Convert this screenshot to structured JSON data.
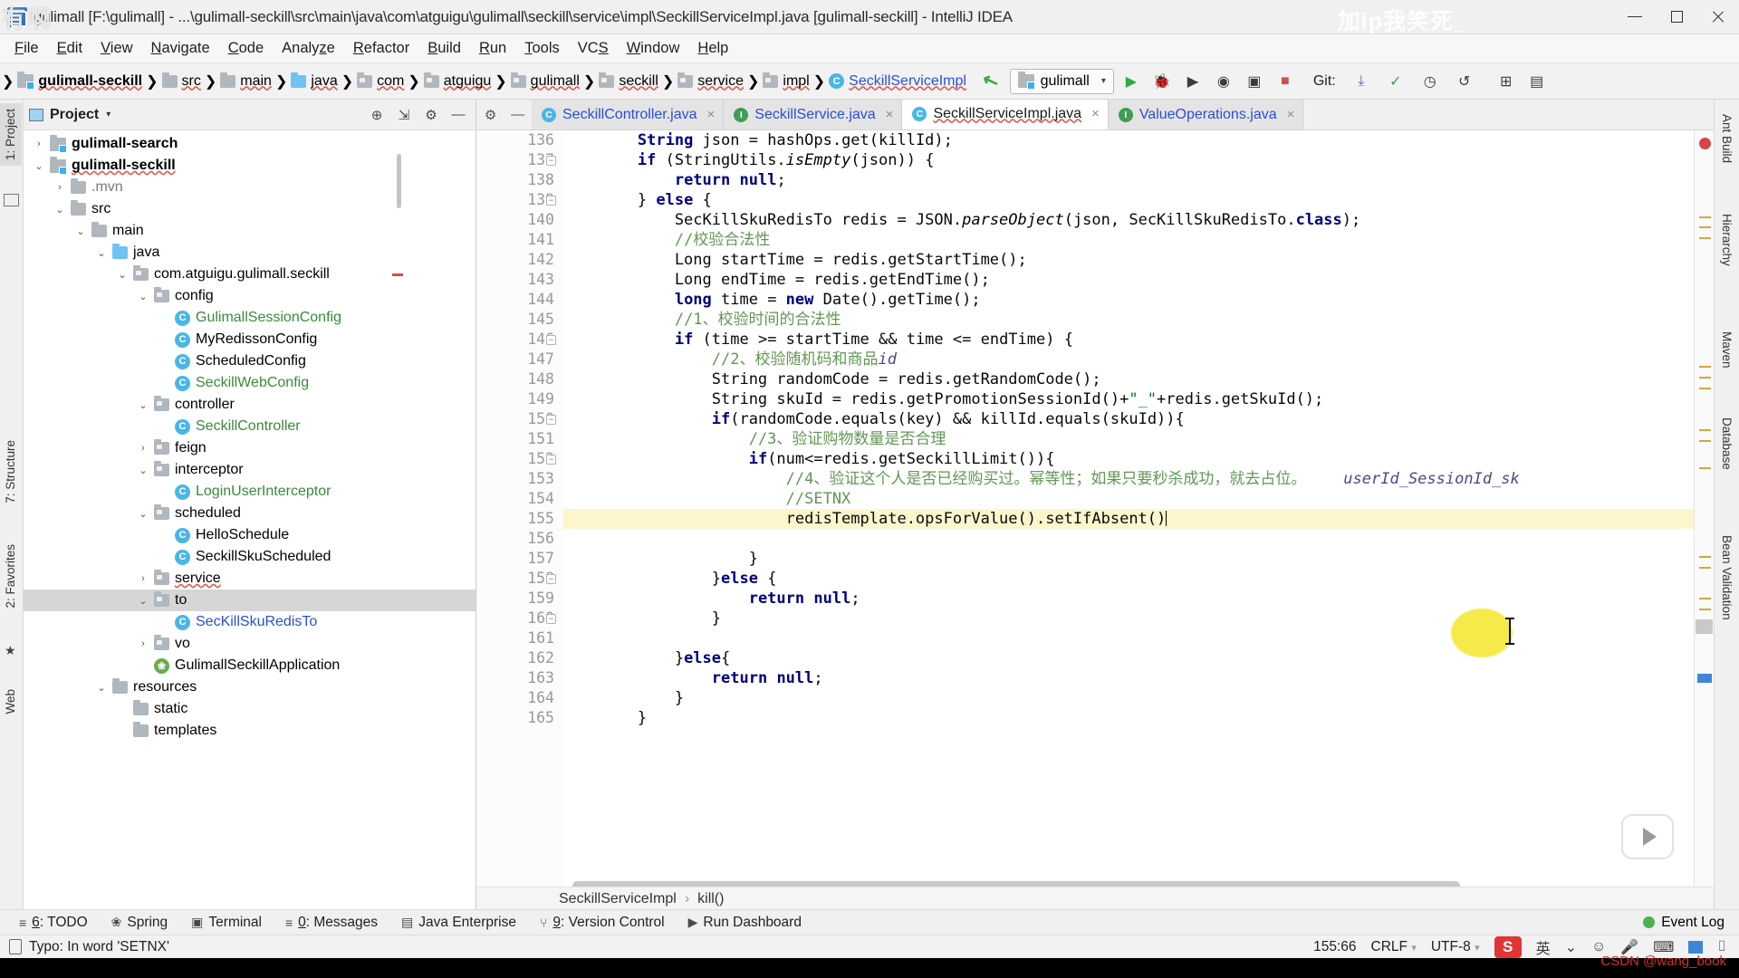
{
  "window": {
    "title": "gulimall [F:\\gulimall] - ...\\gulimall-seckill\\src\\main\\java\\com\\atguigu\\gulimall\\seckill\\service\\impl\\SeckillServiceImpl.java [gulimall-seckill] - IntelliJ IDEA",
    "minimize_label": "minimize",
    "maximize_label": "maximize",
    "close_label": "close"
  },
  "watermarks": {
    "top_left": "有啊",
    "top_right": "加ip我笑死_",
    "bottom_right": "CSDN @wang_book"
  },
  "menu": [
    {
      "label": "File",
      "mnemonic": "F"
    },
    {
      "label": "Edit",
      "mnemonic": "E"
    },
    {
      "label": "View",
      "mnemonic": "V"
    },
    {
      "label": "Navigate",
      "mnemonic": "N"
    },
    {
      "label": "Code",
      "mnemonic": "C"
    },
    {
      "label": "Analyze",
      "mnemonic": "z"
    },
    {
      "label": "Refactor",
      "mnemonic": "R"
    },
    {
      "label": "Build",
      "mnemonic": "B"
    },
    {
      "label": "Run",
      "mnemonic": "R"
    },
    {
      "label": "Tools",
      "mnemonic": "T"
    },
    {
      "label": "VCS",
      "mnemonic": "S"
    },
    {
      "label": "Window",
      "mnemonic": "W"
    },
    {
      "label": "Help",
      "mnemonic": "H"
    }
  ],
  "breadcrumb": [
    {
      "label": "gulimall-seckill",
      "icon": "module-icon",
      "style": "module"
    },
    {
      "label": "src",
      "icon": "folder-icon",
      "style": "folder"
    },
    {
      "label": "main",
      "icon": "folder-icon",
      "style": "folder"
    },
    {
      "label": "java",
      "icon": "source-folder-icon",
      "style": "source"
    },
    {
      "label": "com",
      "icon": "package-icon",
      "style": "package"
    },
    {
      "label": "atguigu",
      "icon": "package-icon",
      "style": "package"
    },
    {
      "label": "gulimall",
      "icon": "package-icon",
      "style": "package"
    },
    {
      "label": "seckill",
      "icon": "package-icon",
      "style": "package"
    },
    {
      "label": "service",
      "icon": "package-icon",
      "style": "package"
    },
    {
      "label": "impl",
      "icon": "package-icon",
      "style": "package"
    },
    {
      "label": "SeckillServiceImpl",
      "icon": "class-icon",
      "style": "class"
    }
  ],
  "toolbar": {
    "run_config": "gulimall",
    "git_label": "Git:",
    "run_icon": "run-icon",
    "debug_icon": "debug-icon",
    "coverage_icon": "coverage-icon",
    "profile_icon": "profile-icon",
    "build_icon": "build-icon",
    "stop_icon": "stop-icon",
    "update_icon": "vcs-update-icon",
    "commit_icon": "vcs-commit-icon",
    "history_icon": "vcs-history-icon",
    "rollback_icon": "vcs-rollback-icon",
    "search_everywhere_icon": "search-everywhere-icon",
    "settings_icon": "settings-icon"
  },
  "left_tool_strip": [
    {
      "label": "1: Project",
      "selected": true
    },
    {
      "label": "2: Favorites",
      "selected": false
    },
    {
      "label": "7: Structure",
      "selected": false
    },
    {
      "label": "Web",
      "selected": false
    }
  ],
  "right_tool_strip": [
    {
      "label": "Ant Build"
    },
    {
      "label": "Hierarchy"
    },
    {
      "label": "Maven"
    },
    {
      "label": "Database"
    },
    {
      "label": "Bean Validation"
    }
  ],
  "project_panel": {
    "title": "Project",
    "caret": "▾",
    "actions": [
      "locate-icon",
      "collapse-all-icon",
      "settings-icon",
      "hide-icon"
    ],
    "tree": [
      {
        "depth": 1,
        "arrow": "collapsed",
        "icon": "module-icon",
        "label": "gulimall-search",
        "style": "bold"
      },
      {
        "depth": 1,
        "arrow": "expanded",
        "icon": "module-icon",
        "label": "gulimall-seckill",
        "style": "bold-squiggle"
      },
      {
        "depth": 2,
        "arrow": "collapsed",
        "icon": "folder-icon",
        "label": ".mvn",
        "style": "gray"
      },
      {
        "depth": 2,
        "arrow": "expanded",
        "icon": "folder-icon",
        "label": "src",
        "style": "plain"
      },
      {
        "depth": 3,
        "arrow": "expanded",
        "icon": "folder-icon",
        "label": "main",
        "style": "plain"
      },
      {
        "depth": 4,
        "arrow": "expanded",
        "icon": "source-folder-icon",
        "label": "java",
        "style": "plain"
      },
      {
        "depth": 5,
        "arrow": "expanded",
        "icon": "package-icon",
        "label": "com.atguigu.gulimall.seckill",
        "style": "plain"
      },
      {
        "depth": 6,
        "arrow": "expanded",
        "icon": "package-icon",
        "label": "config",
        "style": "plain"
      },
      {
        "depth": 7,
        "arrow": "none",
        "icon": "class-icon",
        "label": "GulimallSessionConfig",
        "style": "green"
      },
      {
        "depth": 7,
        "arrow": "none",
        "icon": "class-icon",
        "label": "MyRedissonConfig",
        "style": "plain"
      },
      {
        "depth": 7,
        "arrow": "none",
        "icon": "class-icon",
        "label": "ScheduledConfig",
        "style": "plain"
      },
      {
        "depth": 7,
        "arrow": "none",
        "icon": "class-icon",
        "label": "SeckillWebConfig",
        "style": "green"
      },
      {
        "depth": 6,
        "arrow": "expanded",
        "icon": "package-icon",
        "label": "controller",
        "style": "plain"
      },
      {
        "depth": 7,
        "arrow": "none",
        "icon": "class-icon",
        "label": "SeckillController",
        "style": "green"
      },
      {
        "depth": 6,
        "arrow": "collapsed",
        "icon": "package-icon",
        "label": "feign",
        "style": "plain"
      },
      {
        "depth": 6,
        "arrow": "expanded",
        "icon": "package-icon",
        "label": "interceptor",
        "style": "plain"
      },
      {
        "depth": 7,
        "arrow": "none",
        "icon": "class-icon",
        "label": "LoginUserInterceptor",
        "style": "green"
      },
      {
        "depth": 6,
        "arrow": "expanded",
        "icon": "package-icon",
        "label": "scheduled",
        "style": "plain"
      },
      {
        "depth": 7,
        "arrow": "none",
        "icon": "class-icon",
        "label": "HelloSchedule",
        "style": "plain"
      },
      {
        "depth": 7,
        "arrow": "none",
        "icon": "class-icon",
        "label": "SeckillSkuScheduled",
        "style": "plain"
      },
      {
        "depth": 6,
        "arrow": "collapsed",
        "icon": "package-icon",
        "label": "service",
        "style": "squiggle"
      },
      {
        "depth": 6,
        "arrow": "expanded",
        "icon": "package-icon",
        "label": "to",
        "style": "plain",
        "selected": true
      },
      {
        "depth": 7,
        "arrow": "none",
        "icon": "class-icon",
        "label": "SecKillSkuRedisTo",
        "style": "blue"
      },
      {
        "depth": 6,
        "arrow": "collapsed",
        "icon": "package-icon",
        "label": "vo",
        "style": "plain"
      },
      {
        "depth": 6,
        "arrow": "none",
        "icon": "spring-class-icon",
        "label": "GulimallSeckillApplication",
        "style": "plain"
      },
      {
        "depth": 4,
        "arrow": "expanded",
        "icon": "resource-folder-icon",
        "label": "resources",
        "style": "plain"
      },
      {
        "depth": 5,
        "arrow": "none",
        "icon": "folder-icon",
        "label": "static",
        "style": "plain"
      },
      {
        "depth": 5,
        "arrow": "none",
        "icon": "folder-icon",
        "label": "templates",
        "style": "plain"
      }
    ]
  },
  "editor": {
    "tabs": [
      {
        "label": "SeckillController.java",
        "icon": "class-icon",
        "active": false,
        "close": "×"
      },
      {
        "label": "SeckillService.java",
        "icon": "interface-icon",
        "active": false,
        "close": "×"
      },
      {
        "label": "SeckillServiceImpl.java",
        "icon": "class-icon",
        "active": true,
        "close": "×"
      },
      {
        "label": "ValueOperations.java",
        "icon": "interface-icon",
        "active": false,
        "close": "×"
      }
    ],
    "first_line": 136,
    "lines": [
      {
        "n": 136,
        "fold": "",
        "html": "        <span class=\"kw\">String</span> json = hashOps.get(killId);"
      },
      {
        "n": 137,
        "fold": "minus",
        "html": "        <span class=\"kw\">if</span> (StringUtils.<span class=\"it\">isEmpty</span>(json)) {"
      },
      {
        "n": 138,
        "fold": "",
        "html": "            <span class=\"kw\">return</span> <span class=\"kw\">null</span>;"
      },
      {
        "n": 139,
        "fold": "minus",
        "html": "        } <span class=\"kw\">else</span> {"
      },
      {
        "n": 140,
        "fold": "",
        "html": "            SecKillSkuRedisTo redis = JSON.<span class=\"it\">parseObject</span>(json, SecKillSkuRedisTo.<span class=\"kw\">class</span>);"
      },
      {
        "n": 141,
        "fold": "",
        "html": "            <span class=\"cmz\">//校验合法性</span>"
      },
      {
        "n": 142,
        "fold": "",
        "html": "            Long startTime = redis.getStartTime();"
      },
      {
        "n": 143,
        "fold": "",
        "html": "            Long endTime = redis.getEndTime();"
      },
      {
        "n": 144,
        "fold": "",
        "html": "            <span class=\"kw\">long</span> time = <span class=\"kw\">new</span> Date().getTime();"
      },
      {
        "n": 145,
        "fold": "",
        "html": "            <span class=\"cmz\">//1、校验时间的合法性</span>"
      },
      {
        "n": 146,
        "fold": "minus",
        "html": "            <span class=\"kw\">if</span> (time &gt;= startTime &amp;&amp; time &lt;= endTime) {"
      },
      {
        "n": 147,
        "fold": "",
        "html": "                <span class=\"cmz\">//2、校验随机码和商品<span class=\"ital-blue\">id</span></span>"
      },
      {
        "n": 148,
        "fold": "",
        "html": "                String randomCode = redis.getRandomCode();"
      },
      {
        "n": 149,
        "fold": "",
        "html": "                String skuId = redis.getPromotionSessionId()+<span class=\"st\">\"_\"</span>+redis.getSkuId();"
      },
      {
        "n": 150,
        "fold": "minus",
        "html": "                <span class=\"kw\">if</span>(randomCode.equals(key) &amp;&amp; killId.equals(skuId)){"
      },
      {
        "n": 151,
        "fold": "",
        "html": "                    <span class=\"cmz\">//3、验证购物数量是否合理</span>"
      },
      {
        "n": 152,
        "fold": "minus",
        "html": "                    <span class=\"kw\">if</span>(num&lt;=redis.getSeckillLimit()){"
      },
      {
        "n": 153,
        "fold": "",
        "html": "                        <span class=\"cmz\">//4、验证这个人是否已经购买过。幂等性；如果只要秒杀成功，就去占位。</span>    <span class=\"ital-blue\">userId_SessionId_sk</span>"
      },
      {
        "n": 154,
        "fold": "",
        "html": "                        <span class=\"cmz\">//SETNX</span>"
      },
      {
        "n": 155,
        "fold": "",
        "html": "                        redisTemplate.opsForValue().setIfAbsent()",
        "highlight": true
      },
      {
        "n": 156,
        "fold": "",
        "html": ""
      },
      {
        "n": 157,
        "fold": "",
        "html": "                    }"
      },
      {
        "n": 158,
        "fold": "minus",
        "html": "                }<span class=\"kw\">else</span> {"
      },
      {
        "n": 159,
        "fold": "",
        "html": "                    <span class=\"kw\">return</span> <span class=\"kw\">null</span>;"
      },
      {
        "n": 160,
        "fold": "minus",
        "html": "                }"
      },
      {
        "n": 161,
        "fold": "",
        "html": ""
      },
      {
        "n": 162,
        "fold": "",
        "html": "            }<span class=\"kw\">else</span>{"
      },
      {
        "n": 163,
        "fold": "",
        "html": "                <span class=\"kw\">return</span> <span class=\"kw\">null</span>;"
      },
      {
        "n": 164,
        "fold": "",
        "html": "            }"
      },
      {
        "n": 165,
        "fold": "",
        "html": "        }"
      }
    ],
    "footer_breadcrumb": [
      "SeckillServiceImpl",
      "kill()"
    ]
  },
  "bottom_tool_window": {
    "items": [
      {
        "label": "6: TODO",
        "mnemonic": "6",
        "icon": "todo-icon"
      },
      {
        "label": "Spring",
        "mnemonic": "",
        "icon": "spring-icon"
      },
      {
        "label": "Terminal",
        "mnemonic": "",
        "icon": "terminal-icon"
      },
      {
        "label": "0: Messages",
        "mnemonic": "0",
        "icon": "messages-icon"
      },
      {
        "label": "Java Enterprise",
        "mnemonic": "",
        "icon": "java-enterprise-icon"
      },
      {
        "label": "9: Version Control",
        "mnemonic": "9",
        "icon": "version-control-icon"
      },
      {
        "label": "Run Dashboard",
        "mnemonic": "",
        "icon": "run-dashboard-icon"
      }
    ],
    "event_log": "Event Log"
  },
  "status_bar": {
    "message": "Typo: In word 'SETNX'",
    "caret_position": "155:66",
    "line_separator": "CRLF",
    "encoding": "UTF-8",
    "ime_badge": "S",
    "ime_lang": "英",
    "lock_icon": "lock-icon",
    "mic_icon": "microphone-icon",
    "emoji_icon": "emoji-icon",
    "keyboard_icon": "keyboard-icon",
    "tray_icon": "tray-icon"
  }
}
